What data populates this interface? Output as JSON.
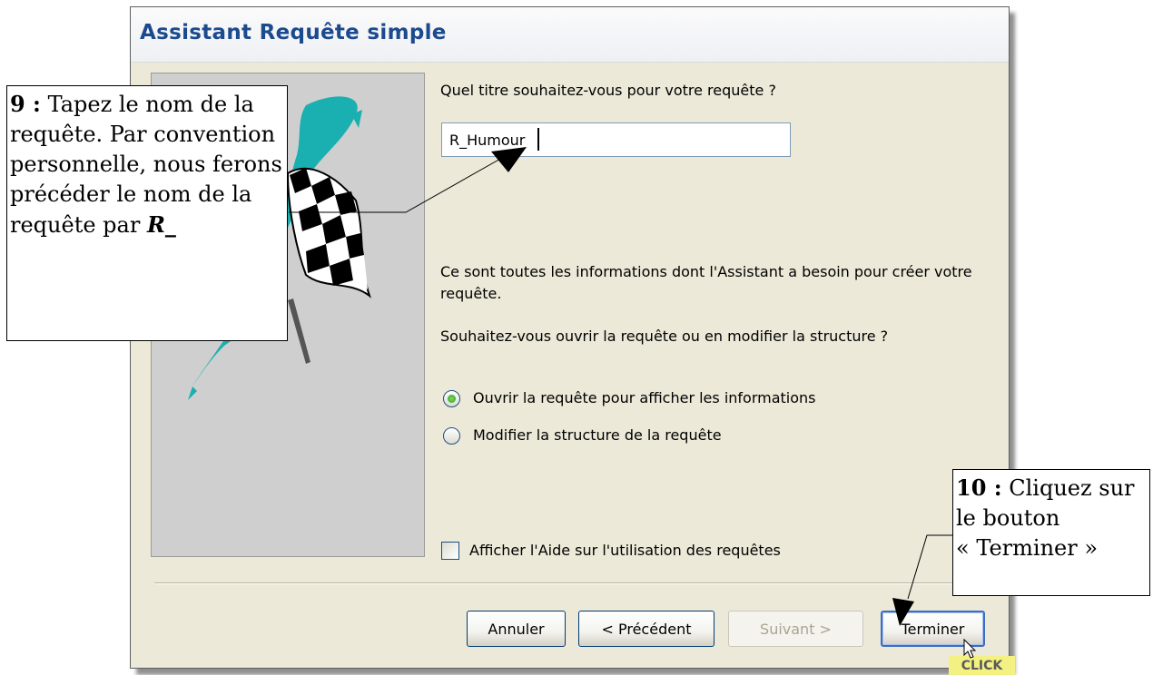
{
  "dialog": {
    "title": "Assistant Requête simple",
    "question_label": "Quel titre souhaitez-vous pour votre requête ?",
    "title_input_value": "R_Humour",
    "info_text": "Ce sont toutes les informations dont l'Assistant a besoin pour créer votre requête.",
    "choice_prompt": "Souhaitez-vous ouvrir la requête ou en modifier la structure ?",
    "radio_open_label": "Ouvrir la requête pour afficher les informations",
    "radio_modify_label": "Modifier la structure de la requête",
    "selected_option": "open",
    "help_checkbox_label": "Afficher l'Aide sur l'utilisation des requêtes",
    "help_checked": false
  },
  "buttons": {
    "cancel": "Annuler",
    "previous": "< Précédent",
    "next": "Suivant >",
    "finish": "Terminer"
  },
  "click_tag": "CLICK",
  "callouts": {
    "step9_num": "9 :",
    "step9_text": "Tapez le nom de la requête. Par convention personnelle, nous ferons précéder le nom de la requête par",
    "step9_mark": "R_",
    "step10_num": "10 :",
    "step10_text_1": "Cliquez sur le bouton",
    "step10_text_2": "« Terminer »"
  },
  "colors": {
    "title_blue": "#1c4a8e",
    "dialog_bg": "#ece9d8",
    "flag_teal": "#1aafb0",
    "radio_green": "#2f9b18"
  }
}
